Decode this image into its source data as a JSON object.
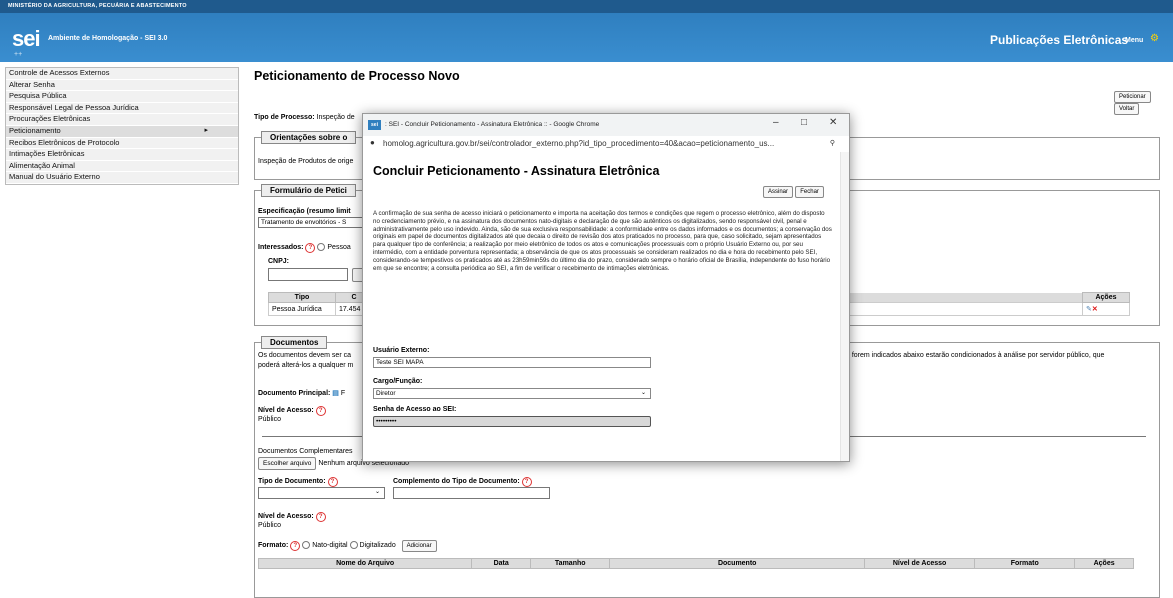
{
  "header": {
    "ministry": "MINISTÉRIO DA AGRICULTURA, PECUÁRIA E ABASTECIMENTO",
    "logo": "sei",
    "environment": "Ambiente de Homologação - SEI 3.0",
    "plusplus": "++",
    "title": "Publicações Eletrônicas",
    "menu": "Menu"
  },
  "sidebar": {
    "items": [
      {
        "label": "Controle de Acessos Externos"
      },
      {
        "label": "Alterar Senha"
      },
      {
        "label": "Pesquisa Pública"
      },
      {
        "label": "Responsável Legal de Pessoa Jurídica"
      },
      {
        "label": "Procurações Eletrônicas"
      },
      {
        "label": "Peticionamento"
      },
      {
        "label": "Recibos Eletrônicos de Protocolo"
      },
      {
        "label": "Intimações Eletrônicas"
      },
      {
        "label": "Alimentação Animal"
      },
      {
        "label": "Manual do Usuário Externo"
      }
    ]
  },
  "main": {
    "title": "Peticionamento de Processo Novo",
    "btn_peticionar": "Peticionar",
    "btn_voltar": "Voltar",
    "tipo_label": "Tipo de Processo:",
    "tipo_value": "Inspeção de",
    "orientacoes_legend": "Orientações sobre o",
    "orientacoes_text": "Inspeção de Produtos de orige",
    "formulario_legend": "Formulário de Petici",
    "especificacao_label": "Especificação (resumo limit",
    "especificacao_value": "Tratamento de envoltórios - S",
    "interessados_label": "Interessados:",
    "pessoa_label": "Pessoa",
    "cnpj_label": "CNPJ:",
    "grid_head": [
      "Tipo",
      "C",
      "Ações"
    ],
    "grid_row": [
      "Pessoa Jurídica",
      "17.454"
    ],
    "documentos_legend": "Documentos",
    "documentos_text_a": "Os documentos devem ser ca",
    "documentos_text_b": "poderá alterá-los a qualquer m",
    "documentos_text_c": "e forem indicados abaixo estarão condicionados à análise por servidor público, que",
    "doc_principal_label": "Documento Principal:",
    "doc_principal_value": "F",
    "nivel_label": "Nível de Acesso:",
    "nivel_value": "Público",
    "complementares_label": "Documentos Complementares",
    "choose_file": "Escolher arquivo",
    "no_file": "Nenhum arquivo selecionado",
    "tipo_doc_label": "Tipo de Documento:",
    "complemento_label": "Complemento do Tipo de Documento:",
    "nivel2_label": "Nível de Acesso:",
    "nivel2_value": "Público",
    "formato_label": "Formato:",
    "nato_digital": "Nato-digital",
    "digitalizado": "Digitalizado",
    "adicionar": "Adicionar",
    "files_head": [
      "Nome do Arquivo",
      "Data",
      "Tamanho",
      "Documento",
      "Nível de Acesso",
      "Formato",
      "Ações"
    ]
  },
  "dialog": {
    "window_title": ": SEI - Concluir Peticionamento - Assinatura Eletrônica :: - Google Chrome",
    "url": "homolog.agricultura.gov.br/sei/controlador_externo.php?id_tipo_procedimento=40&acao=peticionamento_us...",
    "heading": "Concluir Peticionamento - Assinatura Eletrônica",
    "btn_assinar": "Assinar",
    "btn_fechar": "Fechar",
    "paragraph": "A confirmação de sua senha de acesso iniciará o peticionamento e importa na aceitação dos termos e condições que regem o processo eletrônico, além do disposto no credenciamento prévio, e na assinatura dos documentos nato-digitais e declaração de que são autênticos os digitalizados, sendo responsável civil, penal e administrativamente pelo uso indevido. Ainda, são de sua exclusiva responsabilidade: a conformidade entre os dados informados e os documentos; a conservação dos originais em papel de documentos digitalizados até que decaia o direito de revisão dos atos praticados no processo, para que, caso solicitado, sejam apresentados para qualquer tipo de conferência; a realização por meio eletrônico de todos os atos e comunicações processuais com o próprio Usuário Externo ou, por seu intermédio, com a entidade porventura representada; a observância de que os atos processuais se consideram realizados no dia e hora do recebimento pelo SEI, considerando-se tempestivos os praticados até as 23h59min59s do último dia do prazo, considerado sempre o horário oficial de Brasília, independente do fuso horário em que se encontre; a consulta periódica ao SEI, a fim de verificar o recebimento de intimações eletrônicas.",
    "usuario_label": "Usuário Externo:",
    "usuario_value": "Teste SEI MAPA",
    "cargo_label": "Cargo/Função:",
    "cargo_value": "Diretor",
    "senha_label": "Senha de Acesso ao SEI:",
    "senha_value": "•••••••••"
  }
}
